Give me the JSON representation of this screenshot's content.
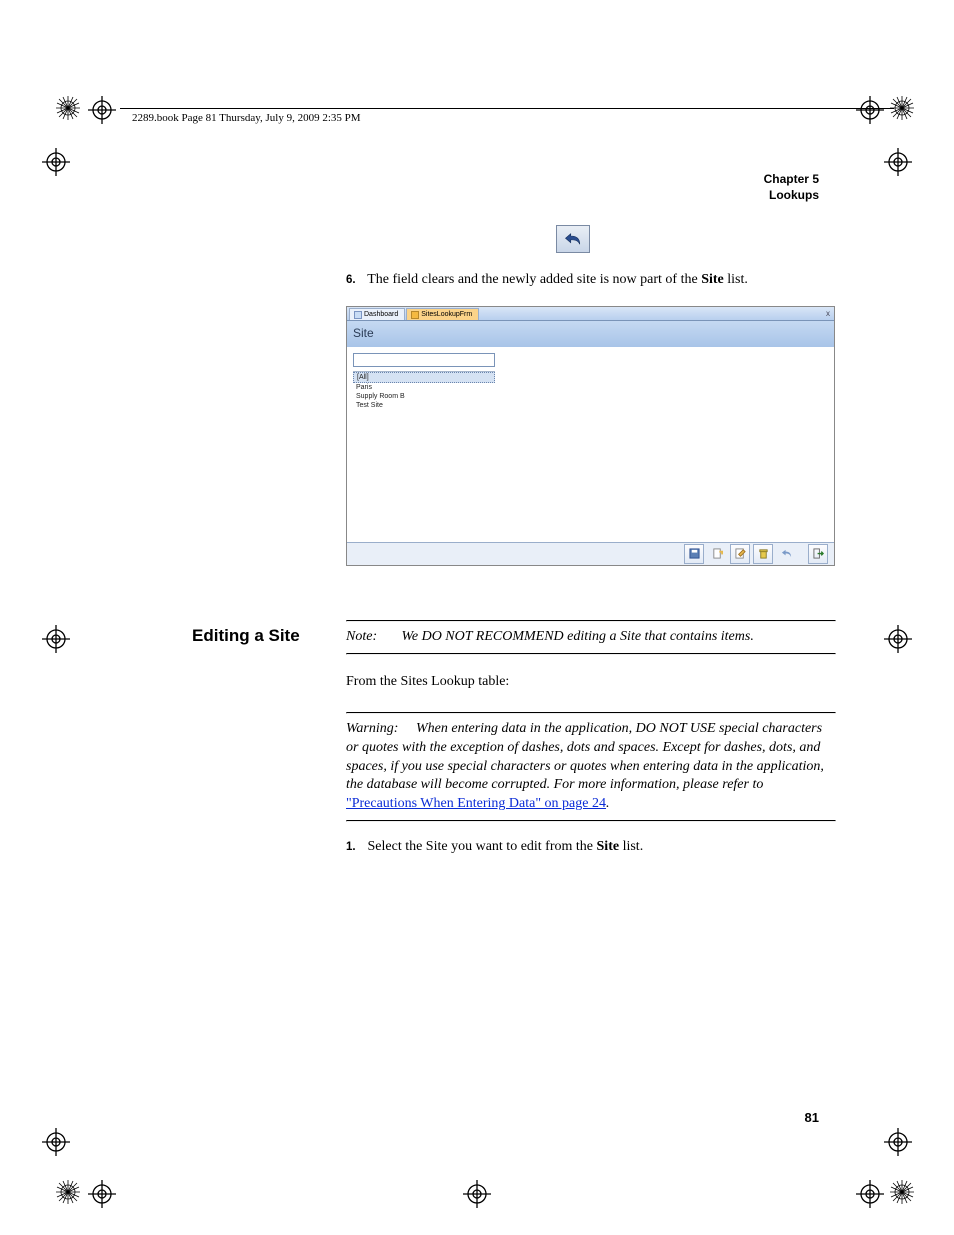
{
  "header": {
    "running": "2289.book  Page 81  Thursday, July 9, 2009  2:35 PM"
  },
  "chapter": {
    "line1": "Chapter 5",
    "line2": "Lookups"
  },
  "steps": {
    "six_num": "6.",
    "six_text_a": "The field clears and the newly added site is now part of the ",
    "six_bold": "Site",
    "six_text_b": " list.",
    "one_num": "1.",
    "one_text_a": "Select the Site you want to edit from the ",
    "one_bold": "Site",
    "one_text_b": " list."
  },
  "screenshot": {
    "tab1": "Dashboard",
    "tab2": "SitesLookupFrm",
    "close_x": "x",
    "title": "Site",
    "list": {
      "i0": "[All]",
      "i1": "Paris",
      "i2": "Supply Room B",
      "i3": "Test Site"
    }
  },
  "section": {
    "heading": "Editing a Site",
    "note_label": "Note:",
    "note_text": "We DO NOT RECOMMEND editing a Site that contains items.",
    "intro": "From the Sites Lookup table:",
    "warn_label": "Warning:",
    "warn_body": "When entering data in the application, DO NOT USE special characters or quotes with the exception of dashes, dots and spaces. Except for dashes, dots, and spaces, if you use special characters or quotes when entering data in the application, the database will become corrupted. For more information, please refer to ",
    "warn_link": "\"Precautions When Entering Data\" on page 24",
    "warn_period": "."
  },
  "page_number": "81"
}
